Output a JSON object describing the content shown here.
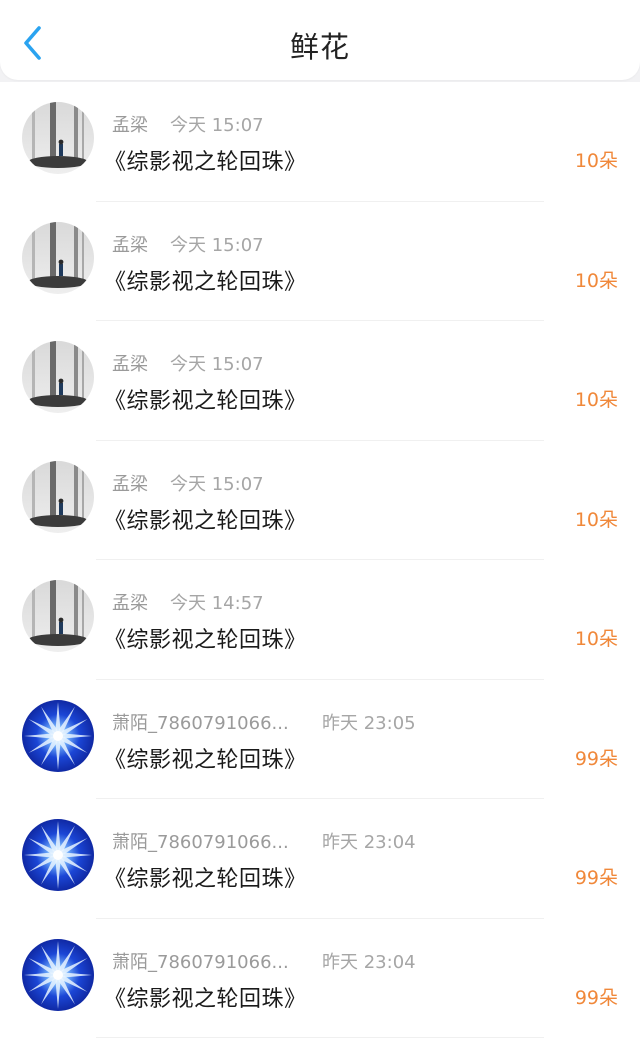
{
  "header": {
    "title": "鲜花",
    "back_icon": "chevron-left-icon",
    "accent": "#2aa3f0"
  },
  "amount_color": "#f0883a",
  "rows": [
    {
      "name": "孟梁",
      "time": "今天 15:07",
      "book": "《综影视之轮回珠》",
      "amount": "10朵",
      "avatar": "winter-scene"
    },
    {
      "name": "孟梁",
      "time": "今天 15:07",
      "book": "《综影视之轮回珠》",
      "amount": "10朵",
      "avatar": "winter-scene"
    },
    {
      "name": "孟梁",
      "time": "今天 15:07",
      "book": "《综影视之轮回珠》",
      "amount": "10朵",
      "avatar": "winter-scene"
    },
    {
      "name": "孟梁",
      "time": "今天 15:07",
      "book": "《综影视之轮回珠》",
      "amount": "10朵",
      "avatar": "winter-scene"
    },
    {
      "name": "孟梁",
      "time": "今天 14:57",
      "book": "《综影视之轮回珠》",
      "amount": "10朵",
      "avatar": "winter-scene"
    },
    {
      "name": "萧陌_7860791066...",
      "time": "昨天 23:05",
      "book": "《综影视之轮回珠》",
      "amount": "99朵",
      "avatar": "blue-star"
    },
    {
      "name": "萧陌_7860791066...",
      "time": "昨天 23:04",
      "book": "《综影视之轮回珠》",
      "amount": "99朵",
      "avatar": "blue-star"
    },
    {
      "name": "萧陌_7860791066...",
      "time": "昨天 23:04",
      "book": "《综影视之轮回珠》",
      "amount": "99朵",
      "avatar": "blue-star"
    }
  ]
}
